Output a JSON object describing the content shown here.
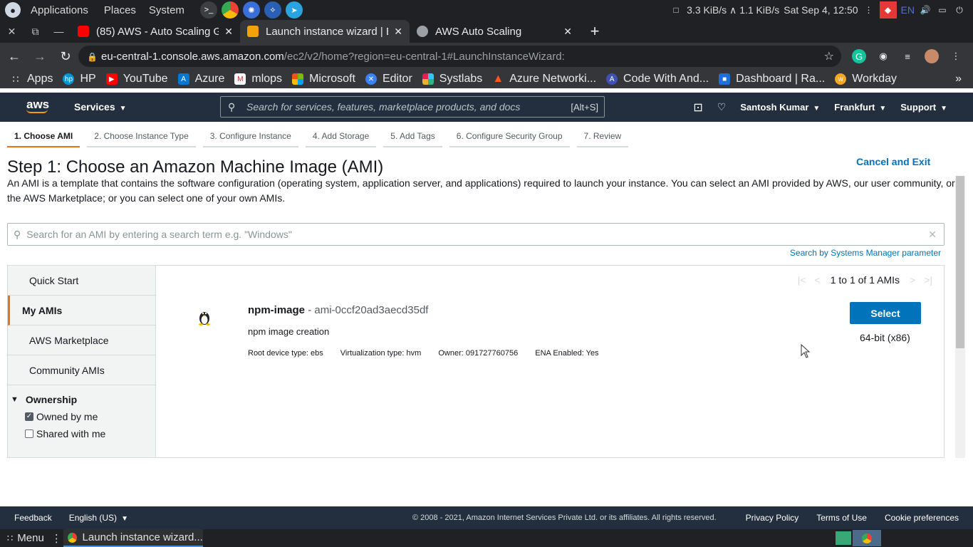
{
  "os": {
    "menu": [
      "Applications",
      "Places",
      "System"
    ],
    "network": "3.3 KiB/s ∧ 1.1 KiB/s",
    "datetime": "Sat Sep  4, 12:50",
    "lang": "EN"
  },
  "browser": {
    "tabs": [
      {
        "title": "(85) AWS - Auto Scaling G",
        "favicon_color": "#ff0000"
      },
      {
        "title": "Launch instance wizard | E",
        "favicon_color": "#f0a30a"
      },
      {
        "title": "AWS Auto Scaling",
        "favicon_color": "#9aa0a6"
      }
    ],
    "url_host": "eu-central-1.console.aws.amazon.com",
    "url_path": "/ec2/v2/home?region=eu-central-1#LaunchInstanceWizard:",
    "bookmarks": [
      "Apps",
      "HP",
      "YouTube",
      "Azure",
      "mlops",
      "Microsoft",
      "Editor",
      "Systlabs",
      "Azure Networki...",
      "Code With And...",
      "Dashboard | Ra...",
      "Workday"
    ]
  },
  "aws_nav": {
    "logo": "aws",
    "services": "Services",
    "search_placeholder": "Search for services, features, marketplace products, and docs",
    "search_shortcut": "[Alt+S]",
    "user": "Santosh Kumar",
    "region": "Frankfurt",
    "support": "Support"
  },
  "wizard": {
    "steps": [
      "1. Choose AMI",
      "2. Choose Instance Type",
      "3. Configure Instance",
      "4. Add Storage",
      "5. Add Tags",
      "6. Configure Security Group",
      "7. Review"
    ],
    "cancel": "Cancel and Exit",
    "title": "Step 1: Choose an Amazon Machine Image (AMI)",
    "description": "An AMI is a template that contains the software configuration (operating system, application server, and applications) required to launch your instance. You can select an AMI provided by AWS, our user community, or the AWS Marketplace; or you can select one of your own AMIs.",
    "search_placeholder": "Search for an AMI by entering a search term e.g. \"Windows\"",
    "ssm_link": "Search by Systems Manager parameter",
    "side_items": [
      "Quick Start",
      "My AMIs",
      "AWS Marketplace",
      "Community AMIs"
    ],
    "ownership": {
      "label": "Ownership",
      "owned": "Owned by me",
      "shared": "Shared with me"
    },
    "pager": "1 to 1 of 1 AMIs",
    "ami": {
      "name": "npm-image",
      "id_text": "- ami-0ccf20ad3aecd35df",
      "description": "npm image creation",
      "root_device": "Root device type: ebs",
      "virtualization": "Virtualization type: hvm",
      "owner": "Owner: 091727760756",
      "ena": "ENA Enabled: Yes",
      "select": "Select",
      "arch": "64-bit (x86)"
    }
  },
  "footer": {
    "feedback": "Feedback",
    "language": "English (US)",
    "copyright": "© 2008 - 2021, Amazon Internet Services Private Ltd. or its affiliates. All rights reserved.",
    "privacy": "Privacy Policy",
    "terms": "Terms of Use",
    "cookies": "Cookie preferences"
  },
  "taskbar": {
    "menu": "Menu",
    "task": "Launch instance wizard..."
  }
}
